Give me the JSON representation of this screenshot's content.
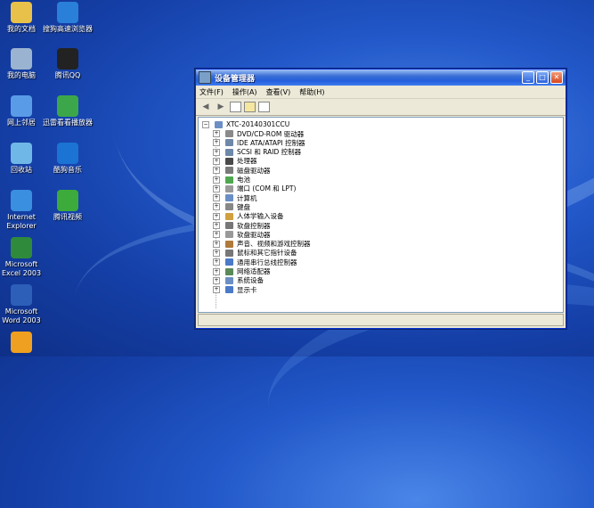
{
  "desktop_icons": [
    {
      "label": "我的文档",
      "color": "#e8c14a"
    },
    {
      "label": "搜狗高速浏览器",
      "color": "#2a7fd8"
    },
    {
      "label": "我的电脑",
      "color": "#9ab3d0"
    },
    {
      "label": "腾讯QQ",
      "color": "#222222"
    },
    {
      "label": "网上邻居",
      "color": "#5a9be8"
    },
    {
      "label": "迅雷看看播放器",
      "color": "#3ca74a"
    },
    {
      "label": "回收站",
      "color": "#6fb7e6"
    },
    {
      "label": "酷狗音乐",
      "color": "#1b73d3"
    },
    {
      "label": "Internet\nExplorer",
      "color": "#3a8fe0"
    },
    {
      "label": "腾讯视频",
      "color": "#3cab3c"
    },
    {
      "label": "Microsoft\nExcel 2003",
      "color": "#2f8a3c"
    },
    {
      "label": "Microsoft\nWord 2003",
      "color": "#2d5fb8"
    },
    {
      "label": "",
      "color": "#f0a020"
    }
  ],
  "window": {
    "title": "设备管理器",
    "menu": [
      "文件(F)",
      "操作(A)",
      "查看(V)",
      "帮助(H)"
    ],
    "toolbar": [
      "back-icon",
      "forward-icon",
      "grid-icon",
      "properties-icon",
      "help-icon"
    ],
    "root": "XTC-20140301CCU",
    "devices": [
      "DVD/CD-ROM 驱动器",
      "IDE ATA/ATAPI 控制器",
      "SCSI 和 RAID 控制器",
      "处理器",
      "磁盘驱动器",
      "电池",
      "端口 (COM 和 LPT)",
      "计算机",
      "键盘",
      "人体学输入设备",
      "软盘控制器",
      "软盘驱动器",
      "声音、视频和游戏控制器",
      "鼠标和其它指针设备",
      "通用串行总线控制器",
      "网络适配器",
      "系统设备",
      "显示卡"
    ],
    "device_colors": [
      "#8a8a8a",
      "#6e88a8",
      "#6e88a8",
      "#4a4a4a",
      "#7a7a7a",
      "#4fa84f",
      "#9a9a9a",
      "#6b8fc4",
      "#888888",
      "#d0a040",
      "#777777",
      "#999999",
      "#b07a3a",
      "#777777",
      "#4a7ac8",
      "#5a8a5a",
      "#6b8fc4",
      "#4a7ac8"
    ],
    "plus": "+",
    "minus": "−",
    "buttons": {
      "min": "_",
      "max": "□",
      "close": "✕"
    }
  }
}
